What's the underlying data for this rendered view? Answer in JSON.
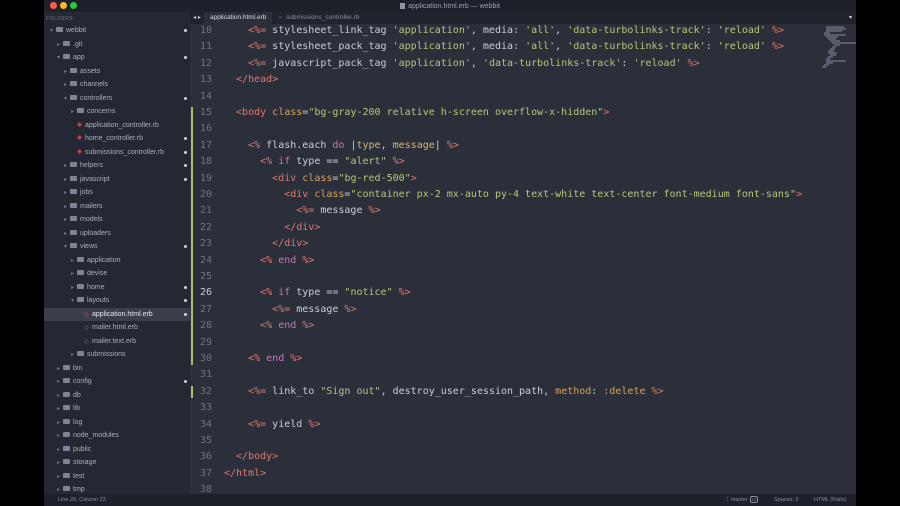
{
  "window": {
    "title": "application.html.erb — webbit"
  },
  "sidebar": {
    "header": "FOLDERS",
    "items": [
      {
        "label": "webbit",
        "depth": 0,
        "kind": "folder",
        "open": true,
        "dot": true
      },
      {
        "label": ".git",
        "depth": 1,
        "kind": "folder",
        "open": false,
        "dot": false
      },
      {
        "label": "app",
        "depth": 1,
        "kind": "folder",
        "open": true,
        "dot": true
      },
      {
        "label": "assets",
        "depth": 2,
        "kind": "folder",
        "open": false,
        "dot": false
      },
      {
        "label": "channels",
        "depth": 2,
        "kind": "folder",
        "open": false,
        "dot": false
      },
      {
        "label": "controllers",
        "depth": 2,
        "kind": "folder",
        "open": true,
        "dot": true
      },
      {
        "label": "concerns",
        "depth": 3,
        "kind": "folder",
        "open": false,
        "dot": false
      },
      {
        "label": "application_controller.rb",
        "depth": 3,
        "kind": "rb",
        "open": false,
        "dot": false
      },
      {
        "label": "home_controller.rb",
        "depth": 3,
        "kind": "rb",
        "open": false,
        "dot": true
      },
      {
        "label": "submissions_controller.rb",
        "depth": 3,
        "kind": "rb",
        "open": false,
        "dot": true
      },
      {
        "label": "helpers",
        "depth": 2,
        "kind": "folder",
        "open": false,
        "dot": true
      },
      {
        "label": "javascript",
        "depth": 2,
        "kind": "folder",
        "open": false,
        "dot": true
      },
      {
        "label": "jobs",
        "depth": 2,
        "kind": "folder",
        "open": false,
        "dot": false
      },
      {
        "label": "mailers",
        "depth": 2,
        "kind": "folder",
        "open": false,
        "dot": false
      },
      {
        "label": "models",
        "depth": 2,
        "kind": "folder",
        "open": false,
        "dot": false
      },
      {
        "label": "uploaders",
        "depth": 2,
        "kind": "folder",
        "open": false,
        "dot": false
      },
      {
        "label": "views",
        "depth": 2,
        "kind": "folder",
        "open": true,
        "dot": true
      },
      {
        "label": "application",
        "depth": 3,
        "kind": "folder",
        "open": false,
        "dot": false
      },
      {
        "label": "devise",
        "depth": 3,
        "kind": "folder",
        "open": false,
        "dot": false
      },
      {
        "label": "home",
        "depth": 3,
        "kind": "folder",
        "open": false,
        "dot": true
      },
      {
        "label": "layouts",
        "depth": 3,
        "kind": "folder",
        "open": true,
        "dot": true
      },
      {
        "label": "application.html.erb",
        "depth": 4,
        "kind": "erb",
        "open": false,
        "dot": true,
        "selected": true
      },
      {
        "label": "mailer.html.erb",
        "depth": 4,
        "kind": "erb",
        "open": false,
        "dot": false
      },
      {
        "label": "mailer.text.erb",
        "depth": 4,
        "kind": "erb",
        "open": false,
        "dot": false
      },
      {
        "label": "submissions",
        "depth": 3,
        "kind": "folder",
        "open": false,
        "dot": false
      },
      {
        "label": "bin",
        "depth": 1,
        "kind": "folder",
        "open": false,
        "dot": false
      },
      {
        "label": "config",
        "depth": 1,
        "kind": "folder",
        "open": false,
        "dot": true
      },
      {
        "label": "db",
        "depth": 1,
        "kind": "folder",
        "open": false,
        "dot": false
      },
      {
        "label": "lib",
        "depth": 1,
        "kind": "folder",
        "open": false,
        "dot": false
      },
      {
        "label": "log",
        "depth": 1,
        "kind": "folder",
        "open": false,
        "dot": false
      },
      {
        "label": "node_modules",
        "depth": 1,
        "kind": "folder",
        "open": false,
        "dot": false
      },
      {
        "label": "public",
        "depth": 1,
        "kind": "folder",
        "open": false,
        "dot": false
      },
      {
        "label": "storage",
        "depth": 1,
        "kind": "folder",
        "open": false,
        "dot": false
      },
      {
        "label": "test",
        "depth": 1,
        "kind": "folder",
        "open": false,
        "dot": false
      },
      {
        "label": "tmp",
        "depth": 1,
        "kind": "folder",
        "open": false,
        "dot": false
      }
    ]
  },
  "tabs": {
    "nav": "◂ ▸",
    "items": [
      {
        "label": "application.html.erb",
        "active": true
      },
      {
        "label": "submissions_controller.rb",
        "active": false
      }
    ],
    "dropdown": "▾"
  },
  "editor": {
    "current_line": 26,
    "lines": [
      {
        "n": 10,
        "tokens": [
          [
            "erb",
            "    <%= "
          ],
          [
            "plain",
            "stylesheet_link_tag "
          ],
          [
            "str",
            "'application'"
          ],
          [
            "plain",
            ", media: "
          ],
          [
            "str",
            "'all'"
          ],
          [
            "plain",
            ", "
          ],
          [
            "str",
            "'data-turbolinks-track'"
          ],
          [
            "plain",
            ": "
          ],
          [
            "str",
            "'reload'"
          ],
          [
            "erb",
            " %>"
          ]
        ]
      },
      {
        "n": 11,
        "tokens": [
          [
            "erb",
            "    <%= "
          ],
          [
            "plain",
            "stylesheet_pack_tag "
          ],
          [
            "str",
            "'application'"
          ],
          [
            "plain",
            ", media: "
          ],
          [
            "str",
            "'all'"
          ],
          [
            "plain",
            ", "
          ],
          [
            "str",
            "'data-turbolinks-track'"
          ],
          [
            "plain",
            ": "
          ],
          [
            "str",
            "'reload'"
          ],
          [
            "erb",
            " %>"
          ]
        ]
      },
      {
        "n": 12,
        "tokens": [
          [
            "erb",
            "    <%= "
          ],
          [
            "plain",
            "javascript_pack_tag "
          ],
          [
            "str",
            "'application'"
          ],
          [
            "plain",
            ", "
          ],
          [
            "str",
            "'data-turbolinks-track'"
          ],
          [
            "plain",
            ": "
          ],
          [
            "str",
            "'reload'"
          ],
          [
            "erb",
            " %>"
          ]
        ]
      },
      {
        "n": 13,
        "tokens": [
          [
            "tag",
            "  </head>"
          ]
        ]
      },
      {
        "n": 14,
        "tokens": []
      },
      {
        "n": 15,
        "tokens": [
          [
            "tag",
            "  <body "
          ],
          [
            "attr",
            "class"
          ],
          [
            "plain",
            "="
          ],
          [
            "str",
            "\"bg-gray-200 relative h-screen overflow-x-hidden\""
          ],
          [
            "tag",
            ">"
          ]
        ]
      },
      {
        "n": 16,
        "tokens": []
      },
      {
        "n": 17,
        "tokens": [
          [
            "erb",
            "    <% "
          ],
          [
            "plain",
            "flash.each "
          ],
          [
            "kw",
            "do"
          ],
          [
            "plain",
            " |"
          ],
          [
            "var",
            "type"
          ],
          [
            "plain",
            ", "
          ],
          [
            "var",
            "message"
          ],
          [
            "plain",
            "| "
          ],
          [
            "erb",
            "%>"
          ]
        ]
      },
      {
        "n": 18,
        "tokens": [
          [
            "erb",
            "      <% "
          ],
          [
            "kw",
            "if"
          ],
          [
            "plain",
            " type == "
          ],
          [
            "str",
            "\"alert\""
          ],
          [
            "erb",
            " %>"
          ]
        ]
      },
      {
        "n": 19,
        "tokens": [
          [
            "tag",
            "        <div "
          ],
          [
            "attr",
            "class"
          ],
          [
            "plain",
            "="
          ],
          [
            "str",
            "\"bg-red-500\""
          ],
          [
            "tag",
            ">"
          ]
        ]
      },
      {
        "n": 20,
        "tokens": [
          [
            "tag",
            "          <div "
          ],
          [
            "attr",
            "class"
          ],
          [
            "plain",
            "="
          ],
          [
            "str",
            "\"container px-2 mx-auto py-4 text-white text-center font-medium font-sans\""
          ],
          [
            "tag",
            ">"
          ]
        ]
      },
      {
        "n": 21,
        "tokens": [
          [
            "erb",
            "            <%= "
          ],
          [
            "plain",
            "message "
          ],
          [
            "erb",
            "%>"
          ]
        ]
      },
      {
        "n": 22,
        "tokens": [
          [
            "tag",
            "          </div>"
          ]
        ]
      },
      {
        "n": 23,
        "tokens": [
          [
            "tag",
            "        </div>"
          ]
        ]
      },
      {
        "n": 24,
        "tokens": [
          [
            "erb",
            "      <% "
          ],
          [
            "kw",
            "end"
          ],
          [
            "erb",
            " %>"
          ]
        ]
      },
      {
        "n": 25,
        "tokens": []
      },
      {
        "n": 26,
        "tokens": [
          [
            "erb",
            "      <% "
          ],
          [
            "kw",
            "if"
          ],
          [
            "plain",
            " type == "
          ],
          [
            "str",
            "\"notice\""
          ],
          [
            "erb",
            " %>"
          ]
        ]
      },
      {
        "n": 27,
        "tokens": [
          [
            "erb",
            "        <%= "
          ],
          [
            "plain",
            "message "
          ],
          [
            "erb",
            "%>"
          ]
        ]
      },
      {
        "n": 28,
        "tokens": [
          [
            "erb",
            "      <% "
          ],
          [
            "kw",
            "end"
          ],
          [
            "erb",
            " %>"
          ]
        ]
      },
      {
        "n": 29,
        "tokens": []
      },
      {
        "n": 30,
        "tokens": [
          [
            "erb",
            "    <% "
          ],
          [
            "kw",
            "end"
          ],
          [
            "erb",
            " %>"
          ]
        ]
      },
      {
        "n": 31,
        "tokens": []
      },
      {
        "n": 32,
        "tokens": [
          [
            "erb",
            "    <%= "
          ],
          [
            "plain",
            "link_to "
          ],
          [
            "str",
            "\"Sign out\""
          ],
          [
            "plain",
            ", destroy_user_session_path, "
          ],
          [
            "attr",
            "method"
          ],
          [
            "plain",
            ": "
          ],
          [
            "attr",
            ":delete"
          ],
          [
            "erb",
            " %>"
          ]
        ]
      },
      {
        "n": 33,
        "tokens": []
      },
      {
        "n": 34,
        "tokens": [
          [
            "erb",
            "    <%= "
          ],
          [
            "plain",
            "yield "
          ],
          [
            "erb",
            "%>"
          ]
        ]
      },
      {
        "n": 35,
        "tokens": []
      },
      {
        "n": 36,
        "tokens": [
          [
            "tag",
            "  </body>"
          ]
        ]
      },
      {
        "n": 37,
        "tokens": [
          [
            "tag",
            "</html>"
          ]
        ]
      },
      {
        "n": 38,
        "tokens": []
      }
    ]
  },
  "statusbar": {
    "position": "Line 26, Column 23",
    "branch": "master",
    "branch_badge": "15",
    "spaces": "Spaces: 2",
    "syntax": "HTML (Rails)"
  },
  "colors": {
    "background": "#2b2f3a",
    "sidebar": "#242832",
    "erb_delimiter": "#e2786b",
    "string": "#b6c77a",
    "keyword": "#c678b6",
    "attribute": "#d7a25f",
    "git_modified": "#a8c267"
  }
}
